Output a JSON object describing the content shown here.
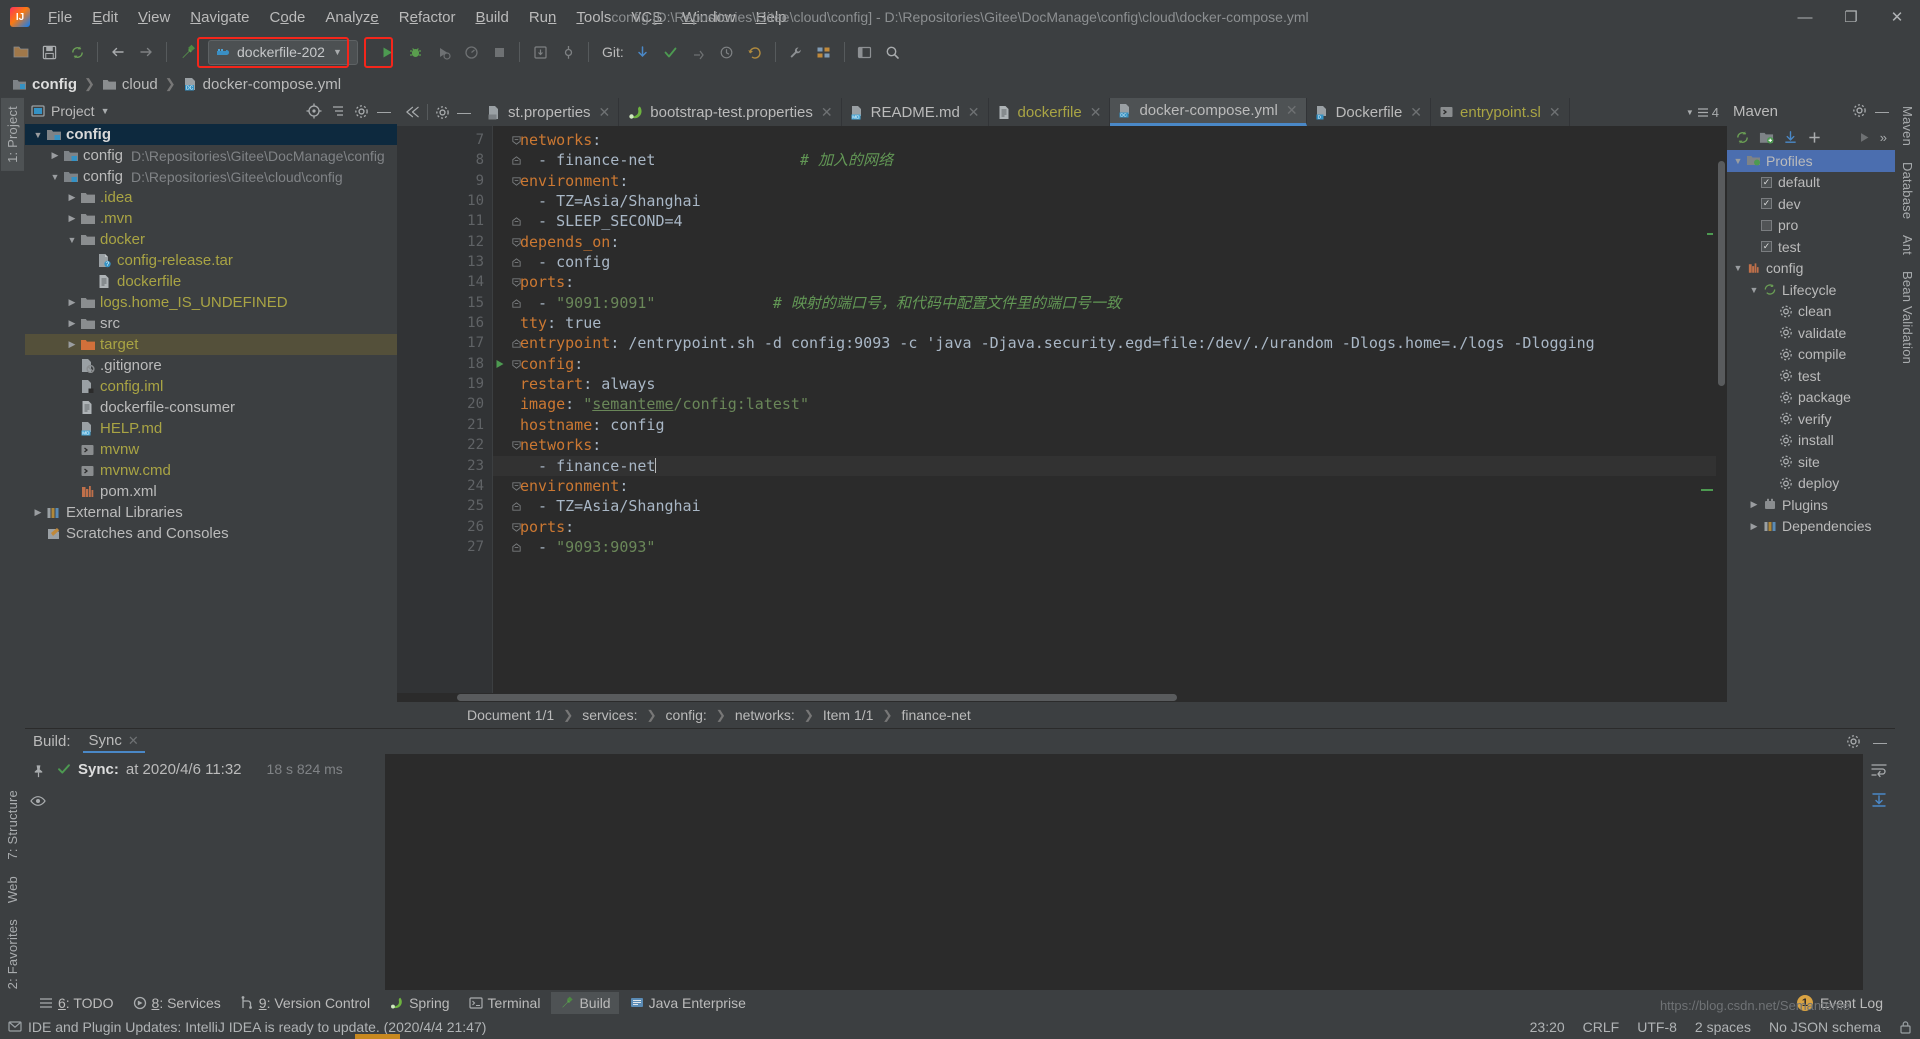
{
  "window": {
    "title": "config [D:\\Repositories\\Gitee\\cloud\\config] - D:\\Repositories\\Gitee\\DocManage\\config\\cloud\\docker-compose.yml",
    "minimize": "—",
    "maximize": "❐",
    "close": "✕"
  },
  "menu": {
    "items": [
      "File",
      "Edit",
      "View",
      "Navigate",
      "Code",
      "Analyze",
      "Refactor",
      "Build",
      "Run",
      "Tools",
      "VCS",
      "Window",
      "Help"
    ]
  },
  "toolbar": {
    "run_config": "dockerfile-202",
    "git_label": "Git:",
    "accent_red": "#f4261b",
    "run_green": "#4d9a51"
  },
  "navbar": {
    "crumbs": [
      "config",
      "cloud",
      "docker-compose.yml"
    ]
  },
  "left_strip": {
    "items": [
      "1: Project",
      "7: Structure",
      "Web",
      "2: Favorites"
    ]
  },
  "right_strip": {
    "items": [
      "Maven",
      "Database",
      "Ant",
      "Bean Validation"
    ]
  },
  "project_panel": {
    "title": "Project",
    "tree": [
      {
        "depth": 0,
        "arrow": "down",
        "icon": "module",
        "label": "config",
        "style": "bold",
        "path": "",
        "state": "selected"
      },
      {
        "depth": 1,
        "arrow": "right",
        "icon": "module",
        "label": "config",
        "style": "plain",
        "path": "D:\\Repositories\\Gitee\\DocManage\\config",
        "state": "none"
      },
      {
        "depth": 1,
        "arrow": "down",
        "icon": "module",
        "label": "config",
        "style": "plain",
        "path": "D:\\Repositories\\Gitee\\cloud\\config",
        "state": "none"
      },
      {
        "depth": 2,
        "arrow": "right",
        "icon": "folder",
        "label": ".idea",
        "style": "yellow",
        "path": "",
        "state": "none"
      },
      {
        "depth": 2,
        "arrow": "right",
        "icon": "folder",
        "label": ".mvn",
        "style": "yellow",
        "path": "",
        "state": "none"
      },
      {
        "depth": 2,
        "arrow": "down",
        "icon": "folder",
        "label": "docker",
        "style": "yellow",
        "path": "",
        "state": "none"
      },
      {
        "depth": 3,
        "arrow": "none",
        "icon": "file-unknown",
        "label": "config-release.tar",
        "style": "yellow",
        "path": "",
        "state": "none"
      },
      {
        "depth": 3,
        "arrow": "none",
        "icon": "file-text",
        "label": "dockerfile",
        "style": "yellow",
        "path": "",
        "state": "none"
      },
      {
        "depth": 2,
        "arrow": "right",
        "icon": "folder",
        "label": "logs.home_IS_UNDEFINED",
        "style": "yellow",
        "path": "",
        "state": "none"
      },
      {
        "depth": 2,
        "arrow": "right",
        "icon": "folder",
        "label": "src",
        "style": "plain",
        "path": "",
        "state": "none"
      },
      {
        "depth": 2,
        "arrow": "right",
        "icon": "folder-orange",
        "label": "target",
        "style": "yellow",
        "path": "",
        "state": "highlight"
      },
      {
        "depth": 2,
        "arrow": "none",
        "icon": "file-ignored",
        "label": ".gitignore",
        "style": "plain",
        "path": "",
        "state": "none"
      },
      {
        "depth": 2,
        "arrow": "none",
        "icon": "file-iml",
        "label": "config.iml",
        "style": "yellow",
        "path": "",
        "state": "none"
      },
      {
        "depth": 2,
        "arrow": "none",
        "icon": "file-text",
        "label": "dockerfile-consumer",
        "style": "plain",
        "path": "",
        "state": "none"
      },
      {
        "depth": 2,
        "arrow": "none",
        "icon": "file-md",
        "label": "HELP.md",
        "style": "yellow",
        "path": "",
        "state": "none"
      },
      {
        "depth": 2,
        "arrow": "none",
        "icon": "file-script",
        "label": "mvnw",
        "style": "yellow",
        "path": "",
        "state": "none"
      },
      {
        "depth": 2,
        "arrow": "none",
        "icon": "file-cmd",
        "label": "mvnw.cmd",
        "style": "yellow",
        "path": "",
        "state": "none"
      },
      {
        "depth": 2,
        "arrow": "none",
        "icon": "file-maven",
        "label": "pom.xml",
        "style": "plain",
        "path": "",
        "state": "none"
      },
      {
        "depth": 0,
        "arrow": "right",
        "icon": "libs",
        "label": "External Libraries",
        "style": "plain",
        "path": "",
        "state": "none"
      },
      {
        "depth": 0,
        "arrow": "none",
        "icon": "scratch",
        "label": "Scratches and Consoles",
        "style": "plain",
        "path": "",
        "state": "none"
      }
    ]
  },
  "editor": {
    "tabs": [
      {
        "label": "st.properties",
        "icon": "file-properties",
        "active": false,
        "color": "plain"
      },
      {
        "label": "bootstrap-test.properties",
        "icon": "spring",
        "active": false,
        "color": "plain"
      },
      {
        "label": "README.md",
        "icon": "file-md",
        "active": false,
        "color": "plain"
      },
      {
        "label": "dockerfile",
        "icon": "file-text",
        "active": false,
        "color": "yellow"
      },
      {
        "label": "docker-compose.yml",
        "icon": "file-dc",
        "active": true,
        "color": "plain"
      },
      {
        "label": "Dockerfile",
        "icon": "file-docker",
        "active": false,
        "color": "plain"
      },
      {
        "label": "entrypoint.sl",
        "icon": "file-script",
        "active": false,
        "color": "yellow"
      }
    ],
    "tab_overflow_count": "4",
    "first_line_number": 7,
    "current_line": 23,
    "lines": [
      {
        "n": 7,
        "fold": "minus",
        "run": false,
        "indent": 1,
        "tokens": [
          {
            "t": "networks",
            "c": "k"
          },
          {
            "t": ":",
            "c": "v"
          }
        ]
      },
      {
        "n": 8,
        "fold": "end",
        "run": false,
        "indent": 2,
        "tokens": [
          {
            "t": "  - finance-net",
            "c": "v"
          },
          {
            "t": "                ",
            "c": "v"
          },
          {
            "t": "# 加入的网络",
            "c": "cm"
          }
        ]
      },
      {
        "n": 9,
        "fold": "minus",
        "run": false,
        "indent": 1,
        "tokens": [
          {
            "t": "environment",
            "c": "k"
          },
          {
            "t": ":",
            "c": "v"
          }
        ]
      },
      {
        "n": 10,
        "fold": "none",
        "run": false,
        "indent": 2,
        "tokens": [
          {
            "t": "  - TZ=Asia/Shanghai",
            "c": "v"
          }
        ]
      },
      {
        "n": 11,
        "fold": "end",
        "run": false,
        "indent": 2,
        "tokens": [
          {
            "t": "  - SLEEP_SECOND=4",
            "c": "v"
          }
        ]
      },
      {
        "n": 12,
        "fold": "minus",
        "run": false,
        "indent": 1,
        "tokens": [
          {
            "t": "depends_on",
            "c": "k"
          },
          {
            "t": ":",
            "c": "v"
          }
        ]
      },
      {
        "n": 13,
        "fold": "end",
        "run": false,
        "indent": 2,
        "tokens": [
          {
            "t": "  - config",
            "c": "v"
          }
        ]
      },
      {
        "n": 14,
        "fold": "minus",
        "run": false,
        "indent": 1,
        "tokens": [
          {
            "t": "ports",
            "c": "k"
          },
          {
            "t": ":",
            "c": "v"
          }
        ]
      },
      {
        "n": 15,
        "fold": "end",
        "run": false,
        "indent": 2,
        "tokens": [
          {
            "t": "  - ",
            "c": "v"
          },
          {
            "t": "\"9091:9091\"",
            "c": "s"
          },
          {
            "t": "             ",
            "c": "v"
          },
          {
            "t": "# 映射的端口号，和代码中配置文件里的端口号一致",
            "c": "cm"
          }
        ]
      },
      {
        "n": 16,
        "fold": "none",
        "run": false,
        "indent": 1,
        "tokens": [
          {
            "t": "tty",
            "c": "k"
          },
          {
            "t": ": true",
            "c": "v"
          }
        ]
      },
      {
        "n": 17,
        "fold": "end",
        "run": false,
        "indent": 1,
        "tokens": [
          {
            "t": "entrypoint",
            "c": "k"
          },
          {
            "t": ": /entrypoint.sh -d config:9093 -c 'java -Djava.security.egd=file:/dev/./urandom -Dlogs.home=./logs -Dlogging",
            "c": "v"
          }
        ]
      },
      {
        "n": 18,
        "fold": "minus",
        "run": true,
        "indent": 0,
        "tokens": [
          {
            "t": "config",
            "c": "k"
          },
          {
            "t": ":",
            "c": "v"
          }
        ]
      },
      {
        "n": 19,
        "fold": "none",
        "run": false,
        "indent": 1,
        "tokens": [
          {
            "t": "restart",
            "c": "k"
          },
          {
            "t": ": always",
            "c": "v"
          }
        ]
      },
      {
        "n": 20,
        "fold": "none",
        "run": false,
        "indent": 1,
        "tokens": [
          {
            "t": "image",
            "c": "k"
          },
          {
            "t": ": ",
            "c": "v"
          },
          {
            "t": "\"",
            "c": "s"
          },
          {
            "t": "semanteme",
            "c": "lnk"
          },
          {
            "t": "/config:latest\"",
            "c": "s"
          }
        ]
      },
      {
        "n": 21,
        "fold": "none",
        "run": false,
        "indent": 1,
        "tokens": [
          {
            "t": "hostname",
            "c": "k"
          },
          {
            "t": ": config",
            "c": "v"
          }
        ]
      },
      {
        "n": 22,
        "fold": "minus",
        "run": false,
        "indent": 1,
        "tokens": [
          {
            "t": "networks",
            "c": "k"
          },
          {
            "t": ":",
            "c": "v"
          }
        ]
      },
      {
        "n": 23,
        "fold": "end",
        "run": false,
        "indent": 2,
        "tokens": [
          {
            "t": "  - finance-net",
            "c": "v"
          }
        ]
      },
      {
        "n": 24,
        "fold": "minus",
        "run": false,
        "indent": 1,
        "tokens": [
          {
            "t": "environment",
            "c": "k"
          },
          {
            "t": ":",
            "c": "v"
          }
        ]
      },
      {
        "n": 25,
        "fold": "end",
        "run": false,
        "indent": 2,
        "tokens": [
          {
            "t": "  - TZ=Asia/Shanghai",
            "c": "v"
          }
        ]
      },
      {
        "n": 26,
        "fold": "minus",
        "run": false,
        "indent": 1,
        "tokens": [
          {
            "t": "ports",
            "c": "k"
          },
          {
            "t": ":",
            "c": "v"
          }
        ]
      },
      {
        "n": 27,
        "fold": "end",
        "run": false,
        "indent": 2,
        "tokens": [
          {
            "t": "  - ",
            "c": "v"
          },
          {
            "t": "\"9093:9093\"",
            "c": "s"
          }
        ]
      }
    ],
    "breadcrumbs": [
      "Document 1/1",
      "services:",
      "config:",
      "networks:",
      "Item 1/1",
      "finance-net"
    ]
  },
  "maven_panel": {
    "title": "Maven",
    "tree": [
      {
        "depth": 0,
        "arrow": "down",
        "icon": "profiles",
        "label": "Profiles",
        "checkbox": "none",
        "selected": true
      },
      {
        "depth": 1,
        "arrow": "none",
        "icon": "none",
        "label": "default",
        "checkbox": "checked",
        "selected": false
      },
      {
        "depth": 1,
        "arrow": "none",
        "icon": "none",
        "label": "dev",
        "checkbox": "checked",
        "selected": false
      },
      {
        "depth": 1,
        "arrow": "none",
        "icon": "none",
        "label": "pro",
        "checkbox": "unchecked",
        "selected": false
      },
      {
        "depth": 1,
        "arrow": "none",
        "icon": "none",
        "label": "test",
        "checkbox": "checked",
        "selected": false
      },
      {
        "depth": 0,
        "arrow": "down",
        "icon": "maven",
        "label": "config",
        "checkbox": "none",
        "selected": false
      },
      {
        "depth": 1,
        "arrow": "down",
        "icon": "lifecycle",
        "label": "Lifecycle",
        "checkbox": "none",
        "selected": false
      },
      {
        "depth": 2,
        "arrow": "none",
        "icon": "goal",
        "label": "clean",
        "checkbox": "none",
        "selected": false
      },
      {
        "depth": 2,
        "arrow": "none",
        "icon": "goal",
        "label": "validate",
        "checkbox": "none",
        "selected": false
      },
      {
        "depth": 2,
        "arrow": "none",
        "icon": "goal",
        "label": "compile",
        "checkbox": "none",
        "selected": false
      },
      {
        "depth": 2,
        "arrow": "none",
        "icon": "goal",
        "label": "test",
        "checkbox": "none",
        "selected": false
      },
      {
        "depth": 2,
        "arrow": "none",
        "icon": "goal",
        "label": "package",
        "checkbox": "none",
        "selected": false
      },
      {
        "depth": 2,
        "arrow": "none",
        "icon": "goal",
        "label": "verify",
        "checkbox": "none",
        "selected": false
      },
      {
        "depth": 2,
        "arrow": "none",
        "icon": "goal",
        "label": "install",
        "checkbox": "none",
        "selected": false
      },
      {
        "depth": 2,
        "arrow": "none",
        "icon": "goal",
        "label": "site",
        "checkbox": "none",
        "selected": false
      },
      {
        "depth": 2,
        "arrow": "none",
        "icon": "goal",
        "label": "deploy",
        "checkbox": "none",
        "selected": false
      },
      {
        "depth": 1,
        "arrow": "right",
        "icon": "plugins",
        "label": "Plugins",
        "checkbox": "none",
        "selected": false
      },
      {
        "depth": 1,
        "arrow": "right",
        "icon": "deps",
        "label": "Dependencies",
        "checkbox": "none",
        "selected": false
      }
    ]
  },
  "build_panel": {
    "label": "Build:",
    "tab": "Sync",
    "sync_title": "Sync:",
    "sync_detail": "at 2020/4/6 11:32",
    "sync_duration": "18 s 824 ms"
  },
  "bottom_tabs": [
    {
      "label": "6: TODO",
      "icon": "todo-icon",
      "selected": false
    },
    {
      "label": "8: Services",
      "icon": "services-icon",
      "selected": false
    },
    {
      "label": "9: Version Control",
      "icon": "vcs-icon",
      "selected": false
    },
    {
      "label": "Spring",
      "icon": "spring-icon",
      "selected": false
    },
    {
      "label": "Terminal",
      "icon": "terminal-icon",
      "selected": false
    },
    {
      "label": "Build",
      "icon": "build-icon",
      "selected": true
    },
    {
      "label": "Java Enterprise",
      "icon": "java-ee-icon",
      "selected": false
    }
  ],
  "event_log": {
    "label": "Event Log",
    "count": "1"
  },
  "statusbar": {
    "message": "IDE and Plugin Updates: IntelliJ IDEA is ready to update. (2020/4/4 21:47)",
    "caret": "23:20",
    "line_sep": "CRLF",
    "encoding": "UTF-8",
    "indent": "2 spaces",
    "schema": "No JSON schema",
    "watermark": "https://blog.csdn.net/Semanteme"
  }
}
